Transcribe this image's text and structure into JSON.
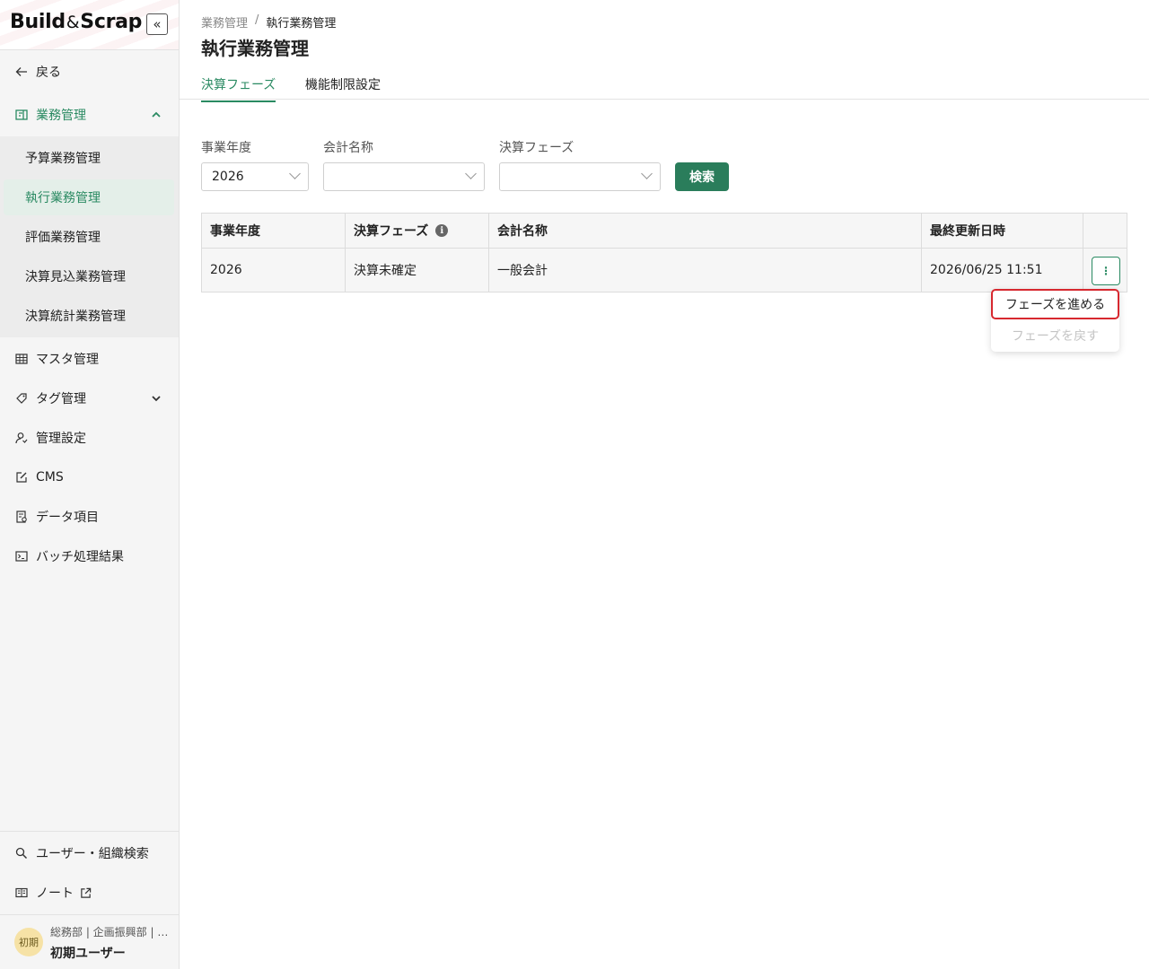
{
  "app": {
    "logo_text": "Build&Scrap",
    "logo_main": "Build",
    "logo_amp": "&",
    "logo_tail": "Scrap",
    "collapse_symbol": "«"
  },
  "sidebar": {
    "back_label": "戻る",
    "groups": [
      {
        "label": "業務管理",
        "icon": "document-icon",
        "expanded": true
      },
      {
        "label": "マスタ管理",
        "icon": "table-icon"
      },
      {
        "label": "タグ管理",
        "icon": "tag-icon",
        "expanded": false
      },
      {
        "label": "管理設定",
        "icon": "user-settings-icon"
      },
      {
        "label": "CMS",
        "icon": "edit-icon"
      },
      {
        "label": "データ項目",
        "icon": "data-item-icon"
      },
      {
        "label": "バッチ処理結果",
        "icon": "terminal-icon"
      }
    ],
    "sub_items": [
      {
        "label": "予算業務管理"
      },
      {
        "label": "執行業務管理",
        "active": true
      },
      {
        "label": "評価業務管理"
      },
      {
        "label": "決算見込業務管理"
      },
      {
        "label": "決算統計業務管理"
      }
    ],
    "bottom": {
      "user_search_label": "ユーザー・組織検索",
      "note_label": "ノート"
    },
    "user": {
      "avatar_text": "初期",
      "org": "総務部 | 企画振興部 | …",
      "name": "初期ユーザー"
    }
  },
  "header": {
    "breadcrumb": [
      "業務管理",
      "/",
      "執行業務管理"
    ],
    "title": "執行業務管理",
    "tabs": [
      {
        "label": "決算フェーズ",
        "active": true
      },
      {
        "label": "機能制限設定",
        "active": false
      }
    ]
  },
  "filters": {
    "fiscal_year": {
      "label": "事業年度",
      "value": "2026"
    },
    "account_name": {
      "label": "会計名称",
      "value": ""
    },
    "phase": {
      "label": "決算フェーズ",
      "value": ""
    },
    "search_button": "検索"
  },
  "table": {
    "columns": [
      "事業年度",
      "決算フェーズ",
      "会計名称",
      "最終更新日時",
      ""
    ],
    "info_glyph": "i",
    "rows": [
      {
        "fiscal_year": "2026",
        "phase": "決算未確定",
        "account": "一般会計",
        "updated": "2026/06/25 11:51",
        "action_glyph": "⋮"
      }
    ]
  },
  "row_menu": {
    "items": [
      {
        "label": "フェーズを進める",
        "enabled": true
      },
      {
        "label": "フェーズを戻す",
        "enabled": false
      }
    ]
  },
  "colors": {
    "accent": "#2a8a62",
    "button": "#2a7d5b",
    "highlight_border": "#d7282f"
  }
}
